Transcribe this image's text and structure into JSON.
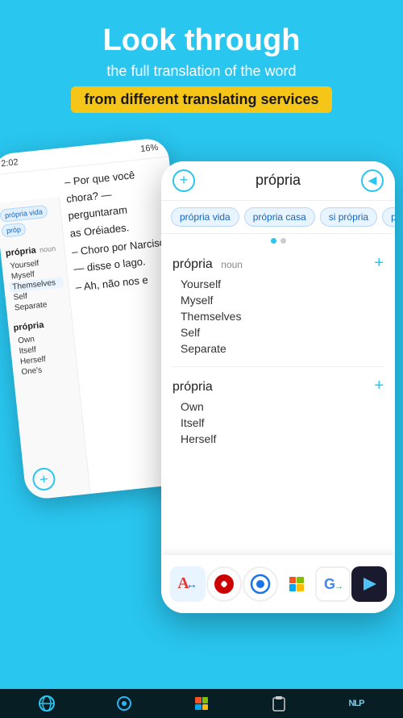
{
  "hero": {
    "title": "Look through",
    "subtitle": "the full translation of the word",
    "highlight": "from different translating services"
  },
  "phone_back": {
    "status_time": "2:02",
    "status_signal": "▲▲▲ □",
    "status_battery": "16%",
    "content_lines": [
      "– Por que você chora? — perguntaram",
      "as Oréiades.",
      "– Choro por Narciso — disse o lago.",
      "– Ah, não nos e"
    ],
    "sidebar_chips": [
      "própria vida",
      "próp"
    ],
    "word1": "própria",
    "word1_pos": "noun",
    "word1_translations": [
      "Yourself",
      "Myself",
      "Themselves",
      "Self",
      "Separate"
    ],
    "word2": "própria",
    "word2_translations": [
      "Own",
      "Itself",
      "Herself",
      "One's"
    ]
  },
  "phone_front": {
    "header_word": "própria",
    "chips": [
      "própria vida",
      "própria casa",
      "si própria",
      "própria c"
    ],
    "dots": [
      true,
      false
    ],
    "section1": {
      "word": "própria",
      "pos": "noun",
      "translations": [
        "Yourself",
        "Myself",
        "Themselves",
        "Self",
        "Separate"
      ]
    },
    "section2": {
      "word": "própria",
      "translations": [
        "Own",
        "Itself",
        "Herself"
      ]
    }
  },
  "bottom_bar_icons": [
    {
      "name": "reverso-icon",
      "label": "A↔"
    },
    {
      "name": "red-circle-icon",
      "label": "●"
    },
    {
      "name": "circle-icon",
      "label": "◎"
    },
    {
      "name": "windows-icon",
      "label": "win"
    },
    {
      "name": "google-translate-icon",
      "label": "G→"
    },
    {
      "name": "source-icon",
      "label": "▶"
    }
  ],
  "taskbar_icons": [
    "🌐",
    "⊙",
    "⊞",
    "📋",
    "NLP"
  ]
}
